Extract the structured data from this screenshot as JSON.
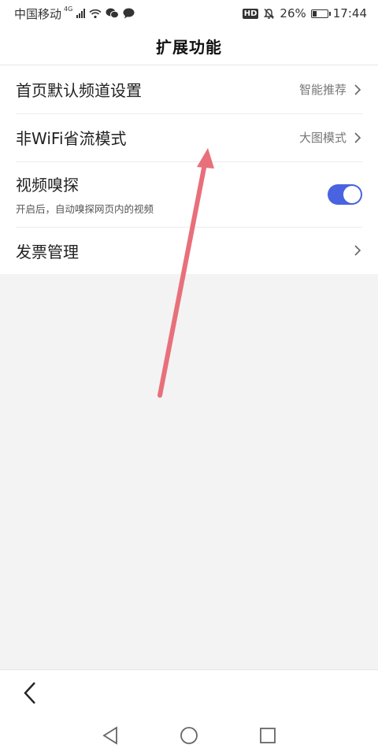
{
  "status_bar": {
    "carrier": "中国移动",
    "network": "4G",
    "battery": "26%",
    "time": "17:44",
    "icons": [
      "signal-icon",
      "wifi-icon",
      "wechat-icon",
      "message-icon",
      "hd-icon",
      "mute-bell-icon",
      "battery-icon"
    ]
  },
  "header": {
    "title": "扩展功能"
  },
  "settings": [
    {
      "label": "首页默认频道设置",
      "value": "智能推荐"
    },
    {
      "label": "非WiFi省流模式",
      "value": "大图模式"
    },
    {
      "label": "视频嗅探",
      "subtitle": "开启后，自动嗅探网页内的视频",
      "toggle_on": true
    },
    {
      "label": "发票管理"
    }
  ],
  "colors": {
    "accent": "#4a63e0",
    "annotation_arrow": "#e8707a",
    "background": "#f3f3f3"
  },
  "nav": {
    "icons": [
      "back-chevron-icon",
      "nav-back-icon",
      "nav-home-icon",
      "nav-recents-icon"
    ]
  }
}
